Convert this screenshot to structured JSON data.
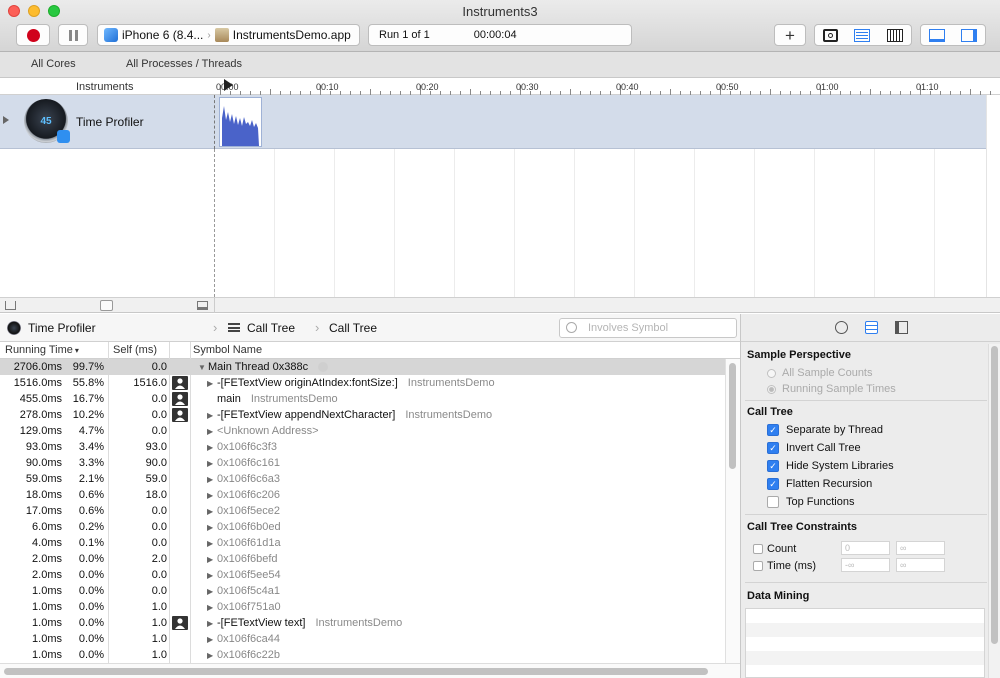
{
  "window": {
    "title": "Instruments3"
  },
  "toolbar": {
    "device": "iPhone 6 (8.4...",
    "app": "InstrumentsDemo.app",
    "run": "Run 1 of 1",
    "elapsed": "00:00:04",
    "add_label": "+"
  },
  "navbar": {
    "tab1": "All Cores",
    "tab2": "All Processes / Threads"
  },
  "ruler": {
    "header": "Instruments",
    "ticks": [
      "00:00",
      "00:10",
      "00:20",
      "00:30",
      "00:40",
      "00:50",
      "01:00",
      "01:10"
    ]
  },
  "instrument": {
    "name": "Time Profiler",
    "gauge": "45"
  },
  "jumpbar": {
    "instrument": "Time Profiler",
    "view1": "Call Tree",
    "view2": "Call Tree",
    "search_placeholder": "Involves Symbol"
  },
  "columns": {
    "running": "Running Time",
    "self": "Self (ms)",
    "symbol": "Symbol Name"
  },
  "rows": [
    {
      "rt": "2706.0ms",
      "pct": "99.7%",
      "self": "0.0",
      "sym": "Main Thread  0x388c",
      "lib": "",
      "disc": "▼",
      "user": false,
      "gray": false,
      "indent": 0
    },
    {
      "rt": "1516.0ms",
      "pct": "55.8%",
      "self": "1516.0",
      "sym": "-[FETextView originAtIndex:fontSize:]",
      "lib": "InstrumentsDemo",
      "disc": "▶",
      "user": true,
      "gray": false,
      "indent": 1
    },
    {
      "rt": "455.0ms",
      "pct": "16.7%",
      "self": "0.0",
      "sym": "main",
      "lib": "InstrumentsDemo",
      "disc": "",
      "user": true,
      "gray": false,
      "indent": 1
    },
    {
      "rt": "278.0ms",
      "pct": "10.2%",
      "self": "0.0",
      "sym": "-[FETextView appendNextCharacter]",
      "lib": "InstrumentsDemo",
      "disc": "▶",
      "user": true,
      "gray": false,
      "indent": 1
    },
    {
      "rt": "129.0ms",
      "pct": "4.7%",
      "self": "0.0",
      "sym": "<Unknown Address>",
      "lib": "",
      "disc": "▶",
      "user": false,
      "gray": true,
      "indent": 1
    },
    {
      "rt": "93.0ms",
      "pct": "3.4%",
      "self": "93.0",
      "sym": "0x106f6c3f3",
      "lib": "",
      "disc": "▶",
      "user": false,
      "gray": true,
      "indent": 1
    },
    {
      "rt": "90.0ms",
      "pct": "3.3%",
      "self": "90.0",
      "sym": "0x106f6c161",
      "lib": "",
      "disc": "▶",
      "user": false,
      "gray": true,
      "indent": 1
    },
    {
      "rt": "59.0ms",
      "pct": "2.1%",
      "self": "59.0",
      "sym": "0x106f6c6a3",
      "lib": "",
      "disc": "▶",
      "user": false,
      "gray": true,
      "indent": 1
    },
    {
      "rt": "18.0ms",
      "pct": "0.6%",
      "self": "18.0",
      "sym": "0x106f6c206",
      "lib": "",
      "disc": "▶",
      "user": false,
      "gray": true,
      "indent": 1
    },
    {
      "rt": "17.0ms",
      "pct": "0.6%",
      "self": "0.0",
      "sym": "0x106f5ece2",
      "lib": "",
      "disc": "▶",
      "user": false,
      "gray": true,
      "indent": 1
    },
    {
      "rt": "6.0ms",
      "pct": "0.2%",
      "self": "0.0",
      "sym": "0x106f6b0ed",
      "lib": "",
      "disc": "▶",
      "user": false,
      "gray": true,
      "indent": 1
    },
    {
      "rt": "4.0ms",
      "pct": "0.1%",
      "self": "0.0",
      "sym": "0x106f61d1a",
      "lib": "",
      "disc": "▶",
      "user": false,
      "gray": true,
      "indent": 1
    },
    {
      "rt": "2.0ms",
      "pct": "0.0%",
      "self": "2.0",
      "sym": "0x106f6befd",
      "lib": "",
      "disc": "▶",
      "user": false,
      "gray": true,
      "indent": 1
    },
    {
      "rt": "2.0ms",
      "pct": "0.0%",
      "self": "0.0",
      "sym": "0x106f5ee54",
      "lib": "",
      "disc": "▶",
      "user": false,
      "gray": true,
      "indent": 1
    },
    {
      "rt": "1.0ms",
      "pct": "0.0%",
      "self": "0.0",
      "sym": "0x106f5c4a1",
      "lib": "",
      "disc": "▶",
      "user": false,
      "gray": true,
      "indent": 1
    },
    {
      "rt": "1.0ms",
      "pct": "0.0%",
      "self": "1.0",
      "sym": "0x106f751a0",
      "lib": "",
      "disc": "▶",
      "user": false,
      "gray": true,
      "indent": 1
    },
    {
      "rt": "1.0ms",
      "pct": "0.0%",
      "self": "1.0",
      "sym": "-[FETextView text]",
      "lib": "InstrumentsDemo",
      "disc": "▶",
      "user": true,
      "gray": false,
      "indent": 1
    },
    {
      "rt": "1.0ms",
      "pct": "0.0%",
      "self": "1.0",
      "sym": "0x106f6ca44",
      "lib": "",
      "disc": "▶",
      "user": false,
      "gray": true,
      "indent": 1
    },
    {
      "rt": "1.0ms",
      "pct": "0.0%",
      "self": "1.0",
      "sym": "0x106f6c22b",
      "lib": "",
      "disc": "▶",
      "user": false,
      "gray": true,
      "indent": 1
    }
  ],
  "inspector": {
    "sample_perspective": {
      "title": "Sample Perspective",
      "opt1": "All Sample Counts",
      "opt2": "Running Sample Times"
    },
    "call_tree": {
      "title": "Call Tree",
      "items": [
        {
          "label": "Separate by Thread",
          "checked": true
        },
        {
          "label": "Invert Call Tree",
          "checked": true
        },
        {
          "label": "Hide System Libraries",
          "checked": true
        },
        {
          "label": "Flatten Recursion",
          "checked": true
        },
        {
          "label": "Top Functions",
          "checked": false
        }
      ]
    },
    "constraints": {
      "title": "Call Tree Constraints",
      "count_label": "Count",
      "count_min": "0",
      "count_max": "∞",
      "time_label": "Time (ms)",
      "time_min": "-∞",
      "time_max": "∞"
    },
    "data_mining": {
      "title": "Data Mining"
    }
  },
  "colors": {
    "accent": "#2f7ff0",
    "track": "#d3dcea",
    "graph": "#4a63c9",
    "record": "#d0021b"
  }
}
